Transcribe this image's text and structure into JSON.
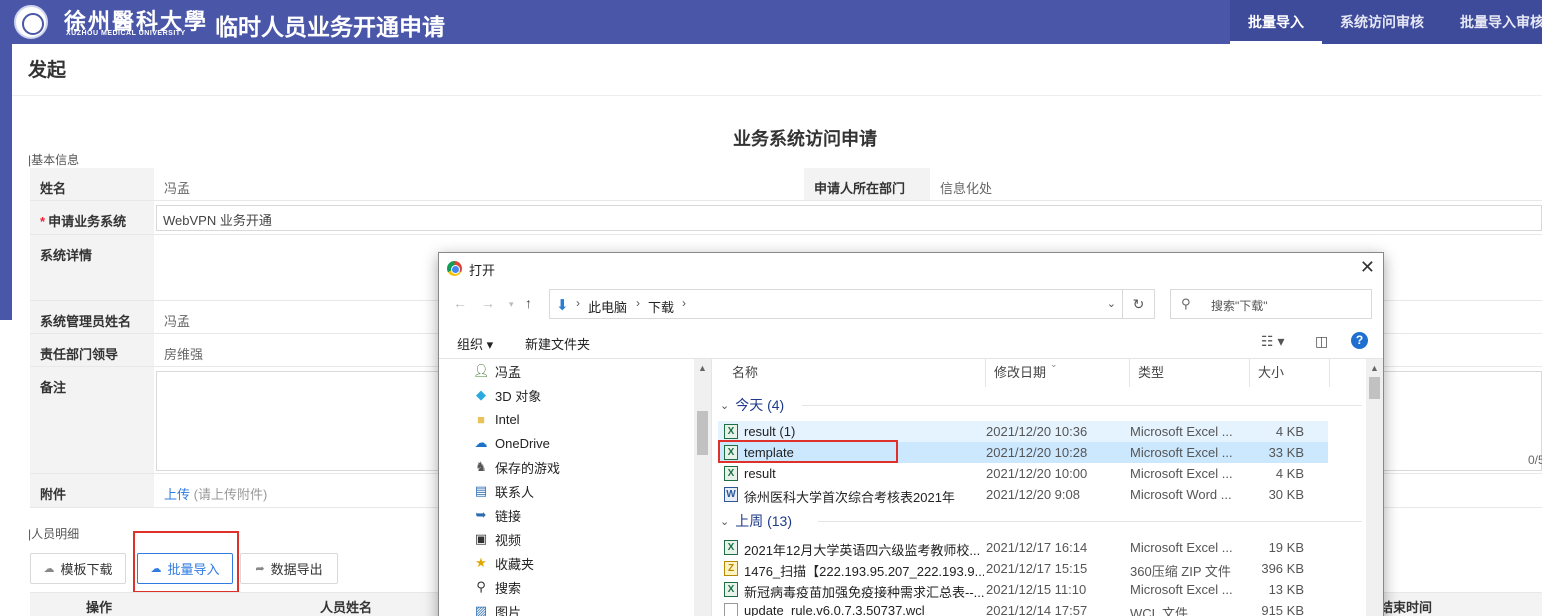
{
  "header": {
    "uni_name_cn": "徐州醫科大學",
    "uni_name_en": "XUZHOU MEDICAL UNIVERSITY",
    "system_title": "临时人员业务开通申请",
    "nav": [
      "批量导入",
      "系统访问审核",
      "批量导入审核"
    ]
  },
  "page": {
    "title": "发起",
    "form_title": "业务系统访问申请",
    "section_basic": "基本信息",
    "section_people": "人员明细"
  },
  "form": {
    "name_label": "姓名",
    "name_value": "冯孟",
    "dept_label": "申请人所在部门",
    "dept_value": "信息化处",
    "system_label": "申请业务系统",
    "system_value": "WebVPN 业务开通",
    "detail_label": "系统详情",
    "admin_label": "系统管理员姓名",
    "admin_value": "冯孟",
    "leader_label": "责任部门领导",
    "leader_value": "房维强",
    "remark_label": "备注",
    "remark_counter": "0/5",
    "attach_label": "附件",
    "upload_link": "上传",
    "upload_hint": "(请上传附件)"
  },
  "toolbar": {
    "template_download": "模板下载",
    "batch_import": "批量导入",
    "data_export": "数据导出"
  },
  "table": {
    "headers": [
      "操作",
      "人员姓名",
      "结束时间"
    ]
  },
  "dialog": {
    "title": "打开",
    "breadcrumb": [
      "此电脑",
      "下载"
    ],
    "search_placeholder": "搜索\"下载\"",
    "organize": "组织 ▾",
    "new_folder": "新建文件夹",
    "nav_items": [
      {
        "label": "冯孟",
        "icon": "user-icon"
      },
      {
        "label": "3D 对象",
        "icon": "cube-icon"
      },
      {
        "label": "Intel",
        "icon": "folder-icon"
      },
      {
        "label": "OneDrive",
        "icon": "cloud-icon"
      },
      {
        "label": "保存的游戏",
        "icon": "game-icon"
      },
      {
        "label": "联系人",
        "icon": "contacts-icon"
      },
      {
        "label": "链接",
        "icon": "link-icon"
      },
      {
        "label": "视频",
        "icon": "video-icon"
      },
      {
        "label": "收藏夹",
        "icon": "star-icon"
      },
      {
        "label": "搜索",
        "icon": "search-icon"
      },
      {
        "label": "图片",
        "icon": "picture-icon"
      }
    ],
    "columns": {
      "name": "名称",
      "date": "修改日期",
      "type": "类型",
      "size": "大小"
    },
    "groups": [
      {
        "label": "今天 (4)",
        "files": [
          {
            "name": "result (1)",
            "date": "2021/12/20 10:36",
            "type": "Microsoft Excel ...",
            "size": "4 KB",
            "kind": "xls"
          },
          {
            "name": "template",
            "date": "2021/12/20 10:28",
            "type": "Microsoft Excel ...",
            "size": "33 KB",
            "kind": "xls"
          },
          {
            "name": "result",
            "date": "2021/12/20 10:00",
            "type": "Microsoft Excel ...",
            "size": "4 KB",
            "kind": "xls"
          },
          {
            "name": "徐州医科大学首次综合考核表2021年",
            "date": "2021/12/20 9:08",
            "type": "Microsoft Word ...",
            "size": "30 KB",
            "kind": "doc"
          }
        ]
      },
      {
        "label": "上周 (13)",
        "files": [
          {
            "name": "2021年12月大学英语四六级监考教师校...",
            "date": "2021/12/17 16:14",
            "type": "Microsoft Excel ...",
            "size": "19 KB",
            "kind": "xls"
          },
          {
            "name": "1476_扫描【222.193.95.207_222.193.9...",
            "date": "2021/12/17 15:15",
            "type": "360压缩 ZIP 文件",
            "size": "396 KB",
            "kind": "zip"
          },
          {
            "name": "新冠病毒疫苗加强免疫接种需求汇总表--...",
            "date": "2021/12/15 11:10",
            "type": "Microsoft Excel ...",
            "size": "13 KB",
            "kind": "xls"
          },
          {
            "name": "update_rule.v6.0.7.3.50737.wcl",
            "date": "2021/12/14 17:57",
            "type": "WCL 文件",
            "size": "915 KB",
            "kind": "txt"
          }
        ]
      }
    ]
  }
}
